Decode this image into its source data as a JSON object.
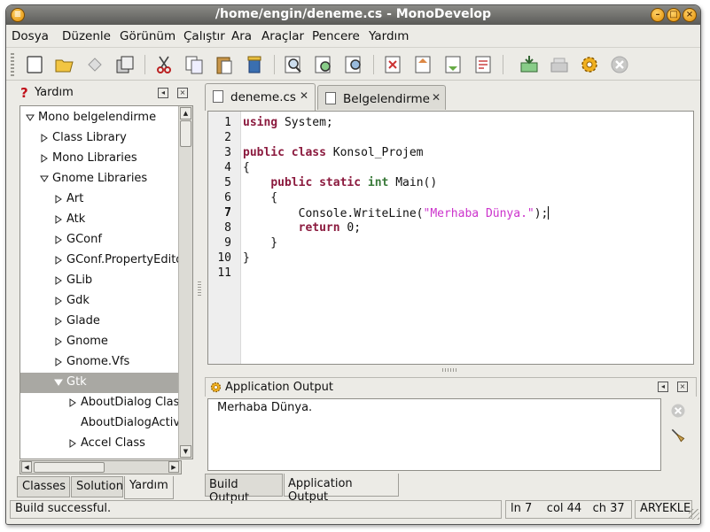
{
  "window": {
    "title": "/home/engin/deneme.cs - MonoDevelop"
  },
  "menubar": {
    "items": [
      "Dosya",
      "Düzenle",
      "Görünüm",
      "Çalıştır",
      "Ara",
      "Araçlar",
      "Pencere",
      "Yardım"
    ]
  },
  "left_pane": {
    "title": "Yardım",
    "tree": [
      {
        "label": "Mono belgelendirme",
        "depth": 0,
        "expanded": true
      },
      {
        "label": "Class Library",
        "depth": 1,
        "expanded": false
      },
      {
        "label": "Mono Libraries",
        "depth": 1,
        "expanded": false
      },
      {
        "label": "Gnome Libraries",
        "depth": 1,
        "expanded": true
      },
      {
        "label": "Art",
        "depth": 2,
        "expanded": false
      },
      {
        "label": "Atk",
        "depth": 2,
        "expanded": false
      },
      {
        "label": "GConf",
        "depth": 2,
        "expanded": false
      },
      {
        "label": "GConf.PropertyEditors",
        "depth": 2,
        "expanded": false
      },
      {
        "label": "GLib",
        "depth": 2,
        "expanded": false
      },
      {
        "label": "Gdk",
        "depth": 2,
        "expanded": false
      },
      {
        "label": "Glade",
        "depth": 2,
        "expanded": false
      },
      {
        "label": "Gnome",
        "depth": 2,
        "expanded": false
      },
      {
        "label": "Gnome.Vfs",
        "depth": 2,
        "expanded": false
      },
      {
        "label": "Gtk",
        "depth": 2,
        "expanded": true,
        "selected": true
      },
      {
        "label": "AboutDialog Class",
        "depth": 3,
        "expanded": false
      },
      {
        "label": "AboutDialogActivateLinkFunc",
        "depth": 3,
        "leaf": true
      },
      {
        "label": "Accel Class",
        "depth": 3,
        "expanded": false
      }
    ],
    "tabs": [
      "Classes",
      "Solution",
      "Yardım"
    ],
    "active_tab": "Yardım"
  },
  "editor": {
    "tabs": [
      {
        "label": "deneme.cs",
        "active": true
      },
      {
        "label": "Belgelendirme",
        "active": false
      }
    ],
    "line_numbers": [
      "1",
      "2",
      "3",
      "4",
      "5",
      "6",
      "7",
      "8",
      "9",
      "10",
      "11"
    ],
    "current_line": 7,
    "code_lines": [
      "using System;",
      "",
      "public class Konsol_Projem",
      "{",
      "    public static int Main()",
      "    {",
      "        Console.WriteLine(\"Merhaba Dünya.\");",
      "        return 0;",
      "    }",
      "}",
      ""
    ]
  },
  "output_pane": {
    "title": "Application Output",
    "text": "Merhaba Dünya.",
    "tabs": [
      "Build Output",
      "Application Output"
    ],
    "active_tab": "Application Output"
  },
  "statusbar": {
    "message": "Build successful.",
    "line": "ln 7",
    "col": "col 44",
    "ch": "ch 37",
    "mode": "ARYEKLE"
  },
  "colors": {
    "keyword": "#8b1a3e",
    "type_keyword": "#3a7a3a",
    "string": "#cc33cc",
    "titlebar": "#6f6f6b",
    "selection": "#a9a8a3"
  }
}
